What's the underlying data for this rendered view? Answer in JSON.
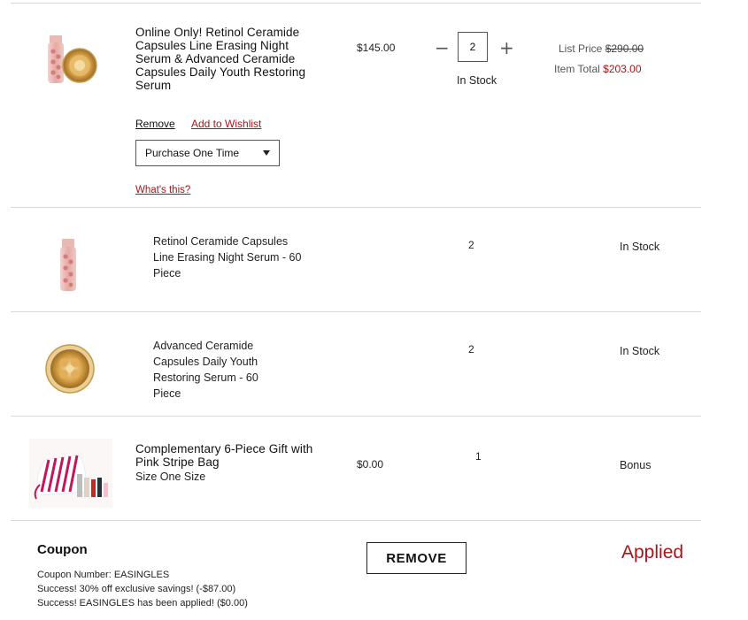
{
  "items": [
    {
      "name": "Online Only! Retinol Ceramide Capsules Line Erasing Night Serum & Advanced Ceramide Capsules Daily Youth Restoring Serum",
      "price": "$145.00",
      "quantity": "2",
      "stock": "In Stock",
      "list_price_label": "List Price",
      "list_price_value": "$290.00",
      "item_total_label": "Item Total",
      "item_total_value": "$203.00",
      "remove_label": "Remove",
      "wishlist_label": "Add to Wishlist",
      "purchase_option": "Purchase One Time",
      "whats_this_label": "What's this?"
    },
    {
      "name": "Retinol Ceramide Capsules Line Erasing Night Serum - 60 Piece",
      "quantity": "2",
      "stock": "In Stock"
    },
    {
      "name": "Advanced Ceramide Capsules Daily Youth Restoring Serum - 60 Piece",
      "quantity": "2",
      "stock": "In Stock"
    },
    {
      "name": "Complementary 6-Piece Gift with Pink Stripe Bag",
      "size": "Size One Size",
      "price": "$0.00",
      "quantity": "1",
      "status": "Bonus"
    }
  ],
  "coupon": {
    "heading": "Coupon",
    "number_line": "Coupon Number: EASINGLES",
    "savings_line": "Success! 30% off exclusive savings! (-$87.00)",
    "applied_line": "Success! EASINGLES has been applied! ($0.00)",
    "remove_button": "REMOVE",
    "status": "Applied"
  },
  "colors": {
    "accent_red": "#a4161a",
    "divider": "#d9d9d9"
  }
}
